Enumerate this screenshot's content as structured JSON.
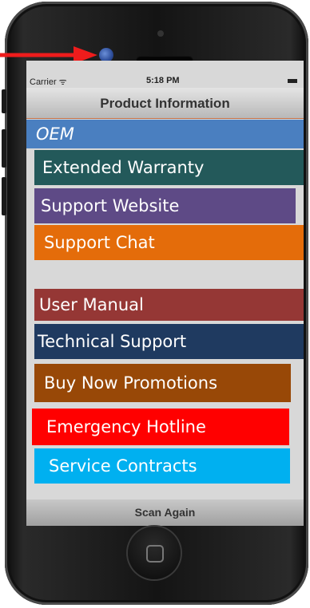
{
  "statusbar": {
    "carrier": "Carrier ᯤ",
    "time": "5:18 PM"
  },
  "header": {
    "title": "Product Information"
  },
  "menu": {
    "items": [
      {
        "label": "OEM",
        "color": "#4a7fc0"
      },
      {
        "label": "Extended Warranty",
        "color": "#23595a"
      },
      {
        "label": "Support Website",
        "color": "#5e4a86"
      },
      {
        "label": "Support Chat",
        "color": "#e46c0a"
      },
      {
        "label": "User Manual",
        "color": "#953735"
      },
      {
        "label": "Technical Support",
        "color": "#1f3a60"
      },
      {
        "label": "Buy Now Promotions",
        "color": "#984807"
      },
      {
        "label": "Emergency Hotline",
        "color": "#ff0000"
      },
      {
        "label": "Service Contracts",
        "color": "#00b0f0"
      }
    ]
  },
  "footer": {
    "scan_again_label": "Scan Again"
  },
  "annotation": {
    "arrow_color": "#ee1c1c"
  }
}
